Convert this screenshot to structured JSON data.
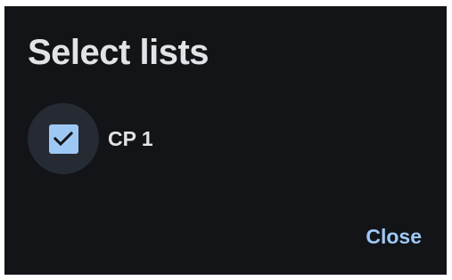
{
  "dialog": {
    "title": "Select lists",
    "options": [
      {
        "label": "CP 1",
        "checked": true
      }
    ],
    "close_label": "Close"
  },
  "colors": {
    "background": "#121418",
    "text": "#e2e3e7",
    "accent": "#9ec8f4",
    "halo": "#252a33"
  }
}
